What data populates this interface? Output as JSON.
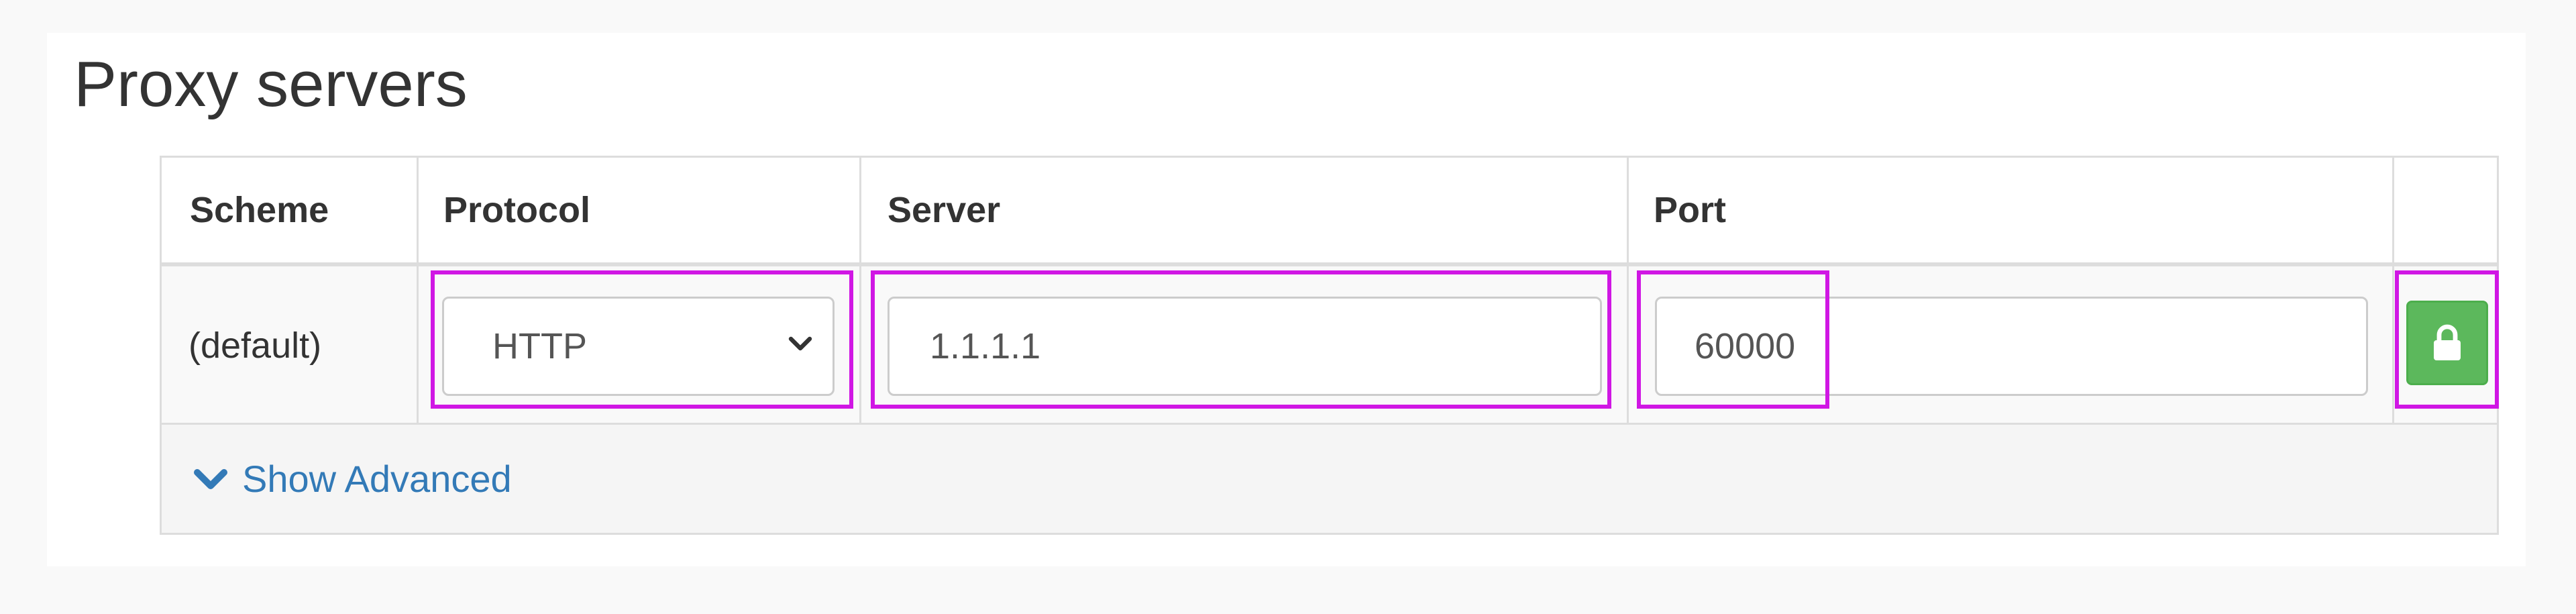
{
  "section": {
    "title": "Proxy servers"
  },
  "table": {
    "headers": {
      "scheme": "Scheme",
      "protocol": "Protocol",
      "server": "Server",
      "port": "Port"
    },
    "row": {
      "scheme": "(default)",
      "protocol": "HTTP",
      "server": "1.1.1.1",
      "port": "60000"
    },
    "lock_button_icon": "lock-icon",
    "show_advanced": {
      "label": "Show Advanced",
      "icon": "chevron-down-icon"
    }
  },
  "colors": {
    "highlight": "#d017e4",
    "lock_button": "#5cb85c",
    "link": "#337ab7"
  }
}
